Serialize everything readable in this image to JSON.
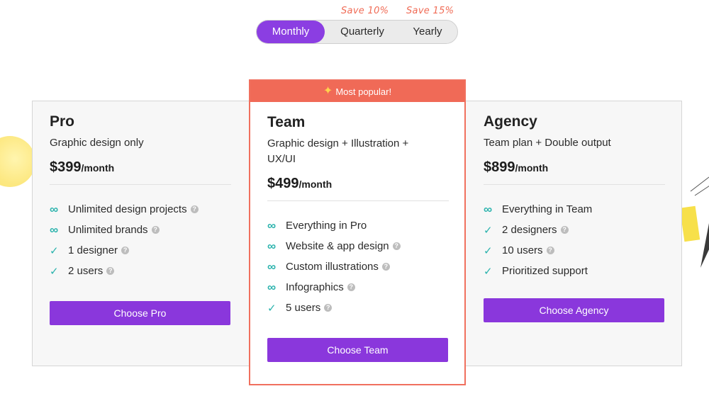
{
  "billing": {
    "options": [
      {
        "label": "Monthly",
        "active": true
      },
      {
        "label": "Quarterly",
        "active": false
      },
      {
        "label": "Yearly",
        "active": false
      }
    ],
    "save_notes": {
      "quarterly": "Save 10%",
      "yearly": "Save 15%"
    }
  },
  "featured_badge": "Most popular!",
  "plans": [
    {
      "name": "Pro",
      "description": "Graphic design only",
      "price": "$399",
      "period": "/month",
      "features": [
        {
          "icon": "infinity-icon",
          "text": "Unlimited design projects",
          "help": true
        },
        {
          "icon": "infinity-icon",
          "text": "Unlimited brands",
          "help": true
        },
        {
          "icon": "check-icon",
          "text": "1 designer",
          "help": true
        },
        {
          "icon": "check-icon",
          "text": "2 users",
          "help": true
        }
      ],
      "button": "Choose Pro"
    },
    {
      "name": "Team",
      "description": "Graphic design + Illustration + UX/UI",
      "price": "$499",
      "period": "/month",
      "features": [
        {
          "icon": "infinity-icon",
          "text": "Everything in Pro",
          "help": false
        },
        {
          "icon": "infinity-icon",
          "text": "Website & app design",
          "help": true
        },
        {
          "icon": "infinity-icon",
          "text": "Custom illustrations",
          "help": true
        },
        {
          "icon": "infinity-icon",
          "text": "Infographics",
          "help": true
        },
        {
          "icon": "check-icon",
          "text": "5 users",
          "help": true
        }
      ],
      "button": "Choose Team"
    },
    {
      "name": "Agency",
      "description": "Team plan + Double output",
      "price": "$899",
      "period": "/month",
      "features": [
        {
          "icon": "infinity-icon",
          "text": "Everything in Team",
          "help": false
        },
        {
          "icon": "check-icon",
          "text": "2 designers",
          "help": true
        },
        {
          "icon": "check-icon",
          "text": "10 users",
          "help": true
        },
        {
          "icon": "check-icon",
          "text": "Prioritized support",
          "help": false
        }
      ],
      "button": "Choose Agency"
    }
  ],
  "colors": {
    "accent": "#8a37dc",
    "featured": "#f06a57",
    "icon": "#2bb3ad",
    "save_note": "#f06b55"
  }
}
